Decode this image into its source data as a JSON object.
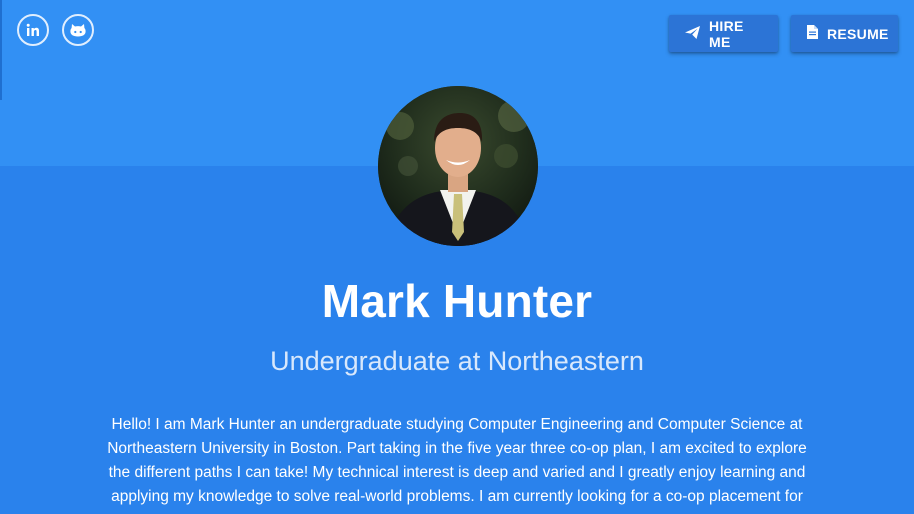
{
  "social": {
    "linkedin_icon": "linkedin-icon",
    "github_icon": "github-icon"
  },
  "actions": {
    "hire_label": "HIRE ME",
    "hire_icon": "send-icon",
    "resume_label": "RESUME",
    "resume_icon": "document-icon"
  },
  "profile": {
    "name": "Mark Hunter",
    "tagline": "Undergraduate at Northeastern",
    "bio": "Hello! I am Mark Hunter an undergraduate studying Computer Engineering and Computer Science at Northeastern University in Boston. Part taking in the five year three co-op plan, I am excited to explore the different paths I can take! My technical interest is deep and varied and I greatly enjoy learning and applying my knowledge to solve real-world problems. I am currently looking for a co-op placement for"
  },
  "colors": {
    "background": "#2a82ec",
    "top_band": "#3290f4",
    "button": "#2c74d6"
  }
}
